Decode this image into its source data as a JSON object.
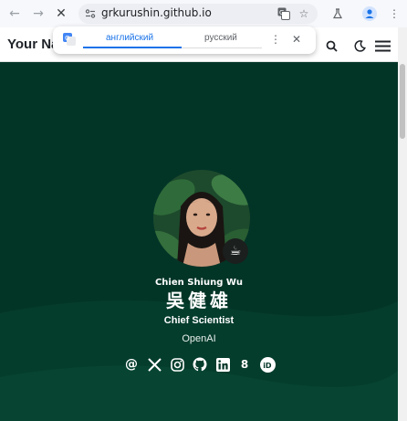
{
  "browser": {
    "url": "grkurushin.github.io",
    "back_icon": "arrow-left-icon",
    "forward_icon": "arrow-right-icon",
    "stop_icon": "close-icon"
  },
  "translate": {
    "source_lang": "английский",
    "target_lang": "русский"
  },
  "header": {
    "brand_visible": "Your Na"
  },
  "profile": {
    "name_en": "Chien Shiung Wu",
    "name_zh": "吳健雄",
    "role": "Chief Scientist",
    "org": "OpenAI"
  },
  "socials": [
    {
      "name": "email-icon",
      "glyph": "@"
    },
    {
      "name": "x-twitter-icon",
      "glyph": "𝕏"
    },
    {
      "name": "instagram-icon",
      "glyph": ""
    },
    {
      "name": "github-icon",
      "glyph": ""
    },
    {
      "name": "linkedin-icon",
      "glyph": "in"
    },
    {
      "name": "google-scholar-icon",
      "glyph": "8"
    },
    {
      "name": "orcid-icon",
      "glyph": "iD"
    }
  ],
  "colors": {
    "hero_bg": "#033527",
    "accent": "#1a73e8"
  }
}
